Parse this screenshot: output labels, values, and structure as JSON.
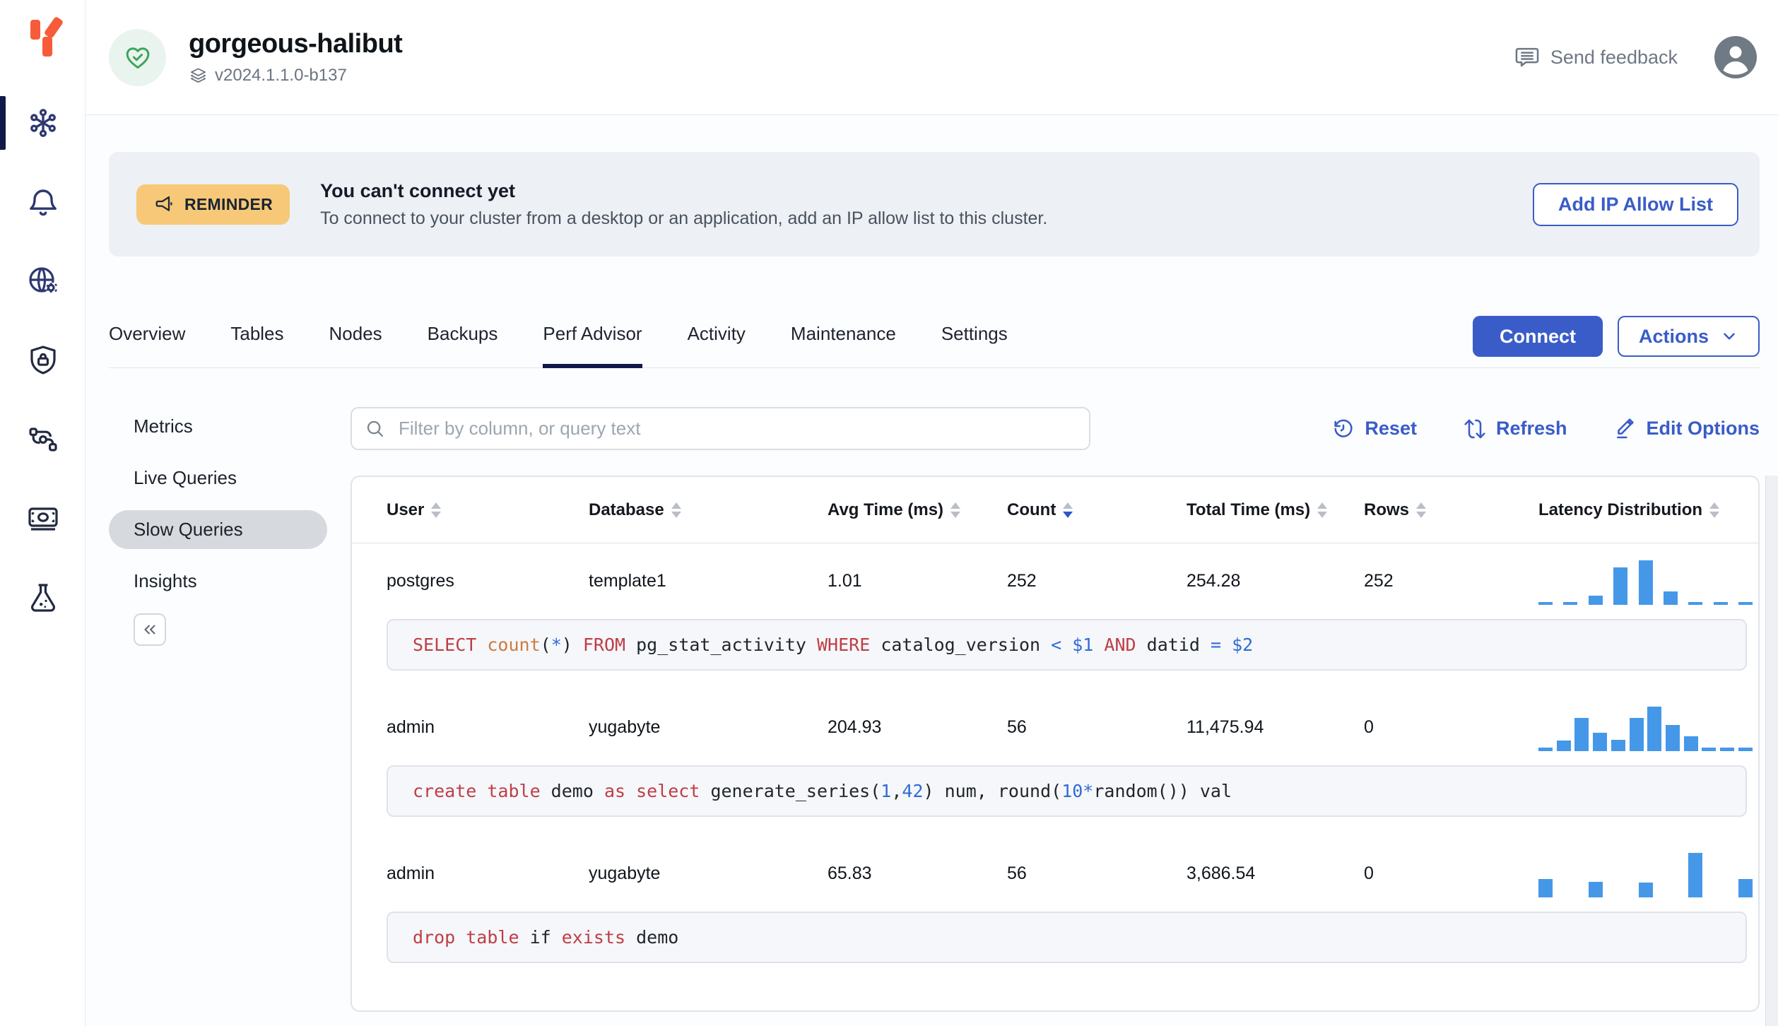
{
  "app": {
    "send_feedback_label": "Send feedback"
  },
  "cluster": {
    "name": "gorgeous-halibut",
    "version": "v2024.1.1.0-b137"
  },
  "banner": {
    "badge": "REMINDER",
    "title": "You can't connect yet",
    "message": "To connect to your cluster from a desktop or an application, add an IP allow list to this cluster.",
    "action": "Add IP Allow List"
  },
  "tabs": {
    "items": [
      "Overview",
      "Tables",
      "Nodes",
      "Backups",
      "Perf Advisor",
      "Activity",
      "Maintenance",
      "Settings"
    ],
    "active": "Perf Advisor"
  },
  "header_actions": {
    "connect": "Connect",
    "actions": "Actions"
  },
  "subnav": {
    "items": [
      "Metrics",
      "Live Queries",
      "Slow Queries",
      "Insights"
    ],
    "active": "Slow Queries"
  },
  "toolbar": {
    "filter_placeholder": "Filter by column, or query text",
    "reset": "Reset",
    "refresh": "Refresh",
    "edit_options": "Edit Options"
  },
  "table": {
    "columns": [
      {
        "label": "User",
        "sort": "none"
      },
      {
        "label": "Database",
        "sort": "none"
      },
      {
        "label": "Avg Time (ms)",
        "sort": "none"
      },
      {
        "label": "Count",
        "sort": "desc"
      },
      {
        "label": "Total Time (ms)",
        "sort": "none"
      },
      {
        "label": "Rows",
        "sort": "none"
      },
      {
        "label": "Latency Distribution",
        "sort": "none"
      }
    ],
    "rows": [
      {
        "user": "postgres",
        "database": "template1",
        "avg_time_ms": "1.01",
        "count": "252",
        "total_time_ms": "254.28",
        "rows": "252",
        "latency_histogram": [
          0.07,
          0.07,
          0.21,
          0.84,
          1,
          0.3,
          0.07,
          0.07,
          0.07
        ],
        "query_tokens": [
          {
            "t": "SELECT ",
            "c": "kw"
          },
          {
            "t": "count",
            "c": "fn"
          },
          {
            "t": "(",
            "c": "p"
          },
          {
            "t": "*",
            "c": "op"
          },
          {
            "t": ") ",
            "c": "p"
          },
          {
            "t": "FROM ",
            "c": "kw"
          },
          {
            "t": "pg_stat_activity ",
            "c": "p"
          },
          {
            "t": "WHERE ",
            "c": "kw"
          },
          {
            "t": "catalog_version ",
            "c": "p"
          },
          {
            "t": "< ",
            "c": "op"
          },
          {
            "t": "$1",
            "c": "num"
          },
          {
            "t": " ",
            "c": "p"
          },
          {
            "t": "AND ",
            "c": "kw"
          },
          {
            "t": "datid ",
            "c": "p"
          },
          {
            "t": "= ",
            "c": "op"
          },
          {
            "t": "$2",
            "c": "num"
          }
        ]
      },
      {
        "user": "admin",
        "database": "yugabyte",
        "avg_time_ms": "204.93",
        "count": "56",
        "total_time_ms": "11,475.94",
        "rows": "0",
        "latency_histogram": [
          0.08,
          0.24,
          0.74,
          0.41,
          0.25,
          0.74,
          1,
          0.58,
          0.33,
          0.08,
          0.08,
          0.08
        ],
        "query_tokens": [
          {
            "t": "create table ",
            "c": "kw"
          },
          {
            "t": "demo ",
            "c": "p"
          },
          {
            "t": "as select ",
            "c": "kw"
          },
          {
            "t": "generate_series(",
            "c": "p"
          },
          {
            "t": "1",
            "c": "num"
          },
          {
            "t": ",",
            "c": "p"
          },
          {
            "t": "42",
            "c": "num"
          },
          {
            "t": ") num, round(",
            "c": "p"
          },
          {
            "t": "10",
            "c": "num"
          },
          {
            "t": "*",
            "c": "op"
          },
          {
            "t": "random()) val",
            "c": "p"
          }
        ]
      },
      {
        "user": "admin",
        "database": "yugabyte",
        "avg_time_ms": "65.83",
        "count": "56",
        "total_time_ms": "3,686.54",
        "rows": "0",
        "latency_histogram": [
          0.41,
          0.35,
          0.34,
          1,
          0.41
        ],
        "query_tokens": [
          {
            "t": "drop table ",
            "c": "kw"
          },
          {
            "t": "if ",
            "c": "p"
          },
          {
            "t": "exists ",
            "c": "kw"
          },
          {
            "t": "demo",
            "c": "p"
          }
        ]
      }
    ]
  },
  "colors": {
    "accent_blue": "#3a5cc8",
    "histogram_bar": "#4598e8",
    "badge_amber": "#f6c877",
    "logo_orange": "#f75b39",
    "health_green": "#3fa35c",
    "sql_keyword": "#bf3e45",
    "sql_function": "#cd7b3e",
    "sql_number": "#2f6cd6",
    "sql_plain": "#21262d"
  }
}
